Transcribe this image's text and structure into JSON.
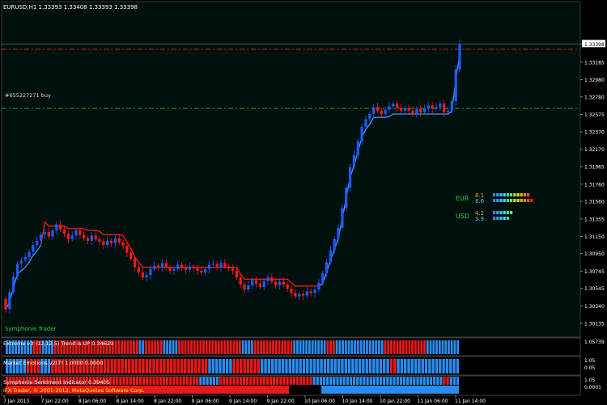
{
  "window": {
    "symbol_line": "EURUSD,H1  1.33393 1.33408 1.33393 1.33398"
  },
  "order_label": "#655227271 buy",
  "watermark": "Symphonie Trader",
  "copyright": "IFX Trader, © 2001-2012, MetaQuotes Software Corp.",
  "colors": {
    "background": "#000000",
    "chart_bg": "#00100d",
    "grid": "#2a2a2a",
    "bull": "#1e5aff",
    "bear": "#ff1a1a",
    "trail_up": "#3d9bff",
    "trail_down": "#ff1a1a",
    "order_line": "#1e9e3a",
    "stop_line": "#c81e1e",
    "panel_blue": "#2a8cf0",
    "panel_red": "#e51a1a",
    "text_green": "#2ecc40"
  },
  "chart_data": [
    {
      "type": "candlestick",
      "title": "EURUSD,H1",
      "price_axis_ticks": [
        "1.33398",
        "1.33185",
        "1.32980",
        "1.32780",
        "1.32575",
        "1.32370",
        "1.32170",
        "1.31965",
        "1.31760",
        "1.31560",
        "1.31355",
        "1.31150",
        "1.30950",
        "1.30745",
        "1.30545",
        "1.30340",
        "1.30135"
      ],
      "current_price": 1.33398,
      "ylim": [
        1.30135,
        1.3359
      ],
      "order_price": 1.32645,
      "stop_line_price": 1.33335,
      "time_axis_labels": [
        "7 Jan 2013",
        "7 Jan 22:00",
        "8 Jan 06:00",
        "8 Jan 14:00",
        "8 Jan 22:00",
        "9 Jan 06:00",
        "9 Jan 14:00",
        "9 Jan 22:00",
        "10 Jan 06:00",
        "10 Jan 14:00",
        "10 Jan 22:00",
        "11 Jan 06:00",
        "11 Jan 14:00"
      ],
      "closes": [
        1.303,
        1.305,
        1.3068,
        1.3083,
        1.3087,
        1.3091,
        1.3097,
        1.3105,
        1.311,
        1.3117,
        1.312,
        1.3115,
        1.3122,
        1.3129,
        1.3123,
        1.3118,
        1.3112,
        1.3116,
        1.3122,
        1.3117,
        1.3113,
        1.311,
        1.3116,
        1.3112,
        1.3109,
        1.3105,
        1.311,
        1.3107,
        1.3113,
        1.3108,
        1.3104,
        1.3096,
        1.3089,
        1.3079,
        1.3073,
        1.3067,
        1.307,
        1.3077,
        1.3081,
        1.3079,
        1.3084,
        1.3079,
        1.3075,
        1.3077,
        1.3082,
        1.3079,
        1.3076,
        1.308,
        1.3078,
        1.3075,
        1.3073,
        1.3077,
        1.3082,
        1.3083,
        1.3079,
        1.3084,
        1.308,
        1.3078,
        1.3075,
        1.3067,
        1.3059,
        1.3053,
        1.3058,
        1.3064,
        1.306,
        1.3056,
        1.3063,
        1.3067,
        1.3062,
        1.3058,
        1.3062,
        1.3059,
        1.3054,
        1.3049,
        1.3045,
        1.3048,
        1.3046,
        1.3051,
        1.3049,
        1.3053,
        1.3061,
        1.3072,
        1.3085,
        1.3099,
        1.3112,
        1.3125,
        1.3148,
        1.3172,
        1.3196,
        1.321,
        1.3226,
        1.3243,
        1.3252,
        1.3258,
        1.3266,
        1.3262,
        1.3258,
        1.3263,
        1.3267,
        1.327,
        1.3265,
        1.3262,
        1.3265,
        1.3262,
        1.3258,
        1.3264,
        1.326,
        1.3264,
        1.3268,
        1.3264,
        1.3266,
        1.327,
        1.326,
        1.3262,
        1.3273,
        1.331,
        1.334
      ],
      "trailing_stop_up_until_index": 9,
      "trailing_stop_down_until_index": 80,
      "strength_meter": [
        {
          "currency": "EUR",
          "values": [
            8.1,
            8.6
          ]
        },
        {
          "currency": "USD",
          "values": [
            4.2,
            3.9
          ]
        }
      ]
    },
    {
      "type": "bar",
      "title": "Extreme v3 (12,12,5) Trend is UP 0.34629",
      "axis_ticks": [
        "1.05739"
      ],
      "segments": [
        {
          "state": "up",
          "count": 9
        },
        {
          "state": "down",
          "count": 3
        },
        {
          "state": "up",
          "count": 4
        },
        {
          "state": "down",
          "count": 28
        },
        {
          "state": "up",
          "count": 2
        },
        {
          "state": "down",
          "count": 6
        },
        {
          "state": "up",
          "count": 5
        },
        {
          "state": "down",
          "count": 21
        },
        {
          "state": "up",
          "count": 4
        },
        {
          "state": "down",
          "count": 13
        },
        {
          "state": "up",
          "count": 11
        },
        {
          "state": "down",
          "count": 3
        },
        {
          "state": "up",
          "count": 16
        },
        {
          "state": "down",
          "count": 14
        },
        {
          "state": "up",
          "count": 11
        }
      ]
    },
    {
      "type": "bar",
      "title": "Market Emotions v2(7) 1.0000 0.0000",
      "axis_ticks": [
        "1.05",
        "0.05"
      ],
      "segments": [
        {
          "state": "up",
          "count": 6
        },
        {
          "state": "down",
          "count": 4
        },
        {
          "state": "up",
          "count": 3
        },
        {
          "state": "down",
          "count": 45
        },
        {
          "state": "up",
          "count": 7
        },
        {
          "state": "down",
          "count": 8
        },
        {
          "state": "up",
          "count": 37
        },
        {
          "state": "down",
          "count": 2
        },
        {
          "state": "up",
          "count": 18
        }
      ]
    },
    {
      "type": "bar",
      "title": "Symphonie Sentiment Indicator 0.39405",
      "axis_ticks": [
        "1.05",
        "0.0001"
      ],
      "segments": [
        {
          "state": "down",
          "count": 58
        },
        {
          "state": "up",
          "count": 6
        },
        {
          "state": "down",
          "count": 28
        },
        {
          "state": "up",
          "count": 39
        },
        {
          "state": "down",
          "count": 2
        },
        {
          "state": "up",
          "count": 3
        }
      ]
    }
  ]
}
